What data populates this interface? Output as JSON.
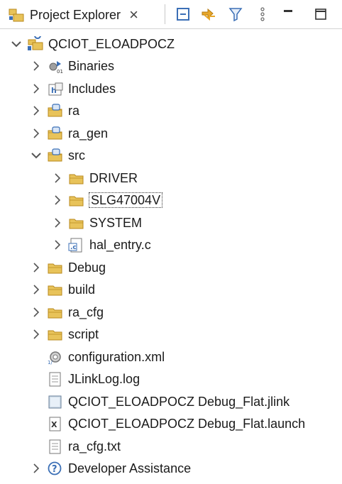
{
  "view": {
    "title": "Project Explorer",
    "close_glyph": "×",
    "toolbar": [
      "collapse-all-icon",
      "link-with-editor-icon",
      "filter-icon",
      "view-menu-icon",
      "minimize-icon",
      "maximize-icon"
    ]
  },
  "tree": [
    {
      "label": "QCIOT_ELOADPOCZ",
      "icon": "project-icon",
      "state": "expanded",
      "level": 0
    },
    {
      "label": "Binaries",
      "icon": "binaries-icon",
      "state": "collapsed",
      "level": 1
    },
    {
      "label": "Includes",
      "icon": "includes-icon",
      "state": "collapsed",
      "level": 1
    },
    {
      "label": "ra",
      "icon": "source-folder-icon",
      "state": "collapsed",
      "level": 1
    },
    {
      "label": "ra_gen",
      "icon": "source-folder-icon",
      "state": "collapsed",
      "level": 1
    },
    {
      "label": "src",
      "icon": "source-folder-icon",
      "state": "expanded",
      "level": 1
    },
    {
      "label": "DRIVER",
      "icon": "folder-icon",
      "state": "collapsed",
      "level": 2
    },
    {
      "label": "SLG47004V",
      "icon": "folder-icon",
      "state": "collapsed",
      "level": 2,
      "focused": true
    },
    {
      "label": "SYSTEM",
      "icon": "folder-icon",
      "state": "collapsed",
      "level": 2
    },
    {
      "label": "hal_entry.c",
      "icon": "c-file-icon",
      "state": "collapsed",
      "level": 2
    },
    {
      "label": "Debug",
      "icon": "folder-icon",
      "state": "collapsed",
      "level": 1
    },
    {
      "label": "build",
      "icon": "folder-icon",
      "state": "collapsed",
      "level": 1
    },
    {
      "label": "ra_cfg",
      "icon": "folder-icon",
      "state": "collapsed",
      "level": 1
    },
    {
      "label": "script",
      "icon": "folder-icon",
      "state": "collapsed",
      "level": 1
    },
    {
      "label": "configuration.xml",
      "icon": "configuration-icon",
      "state": "leaf",
      "level": 1
    },
    {
      "label": "JLinkLog.log",
      "icon": "text-file-icon",
      "state": "leaf",
      "level": 1
    },
    {
      "label": "QCIOT_ELOADPOCZ Debug_Flat.jlink",
      "icon": "jlink-file-icon",
      "state": "leaf",
      "level": 1
    },
    {
      "label": "QCIOT_ELOADPOCZ Debug_Flat.launch",
      "icon": "launch-file-icon",
      "state": "leaf",
      "level": 1
    },
    {
      "label": "ra_cfg.txt",
      "icon": "text-file-icon",
      "state": "leaf",
      "level": 1
    },
    {
      "label": "Developer Assistance",
      "icon": "help-icon",
      "state": "collapsed",
      "level": 1
    }
  ],
  "colors": {
    "folder": "#e8c35a",
    "folder_stroke": "#b88a1e",
    "twisty": "#555555",
    "accent_blue": "#3b6fb6"
  }
}
